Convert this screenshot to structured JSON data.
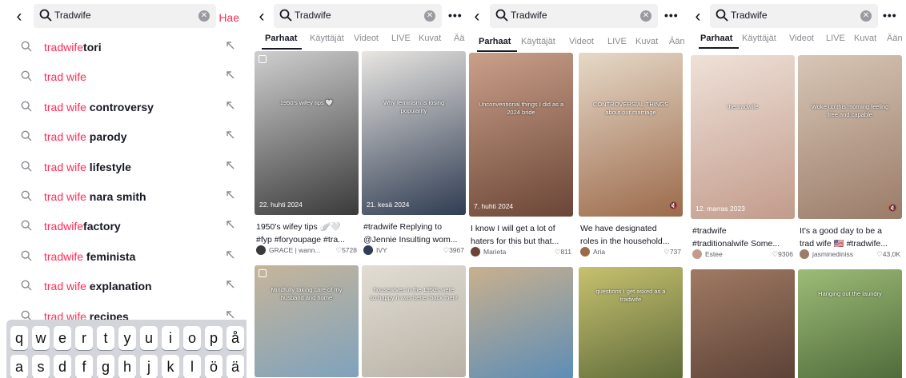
{
  "query": "Tradwife",
  "search_button": "Hae",
  "suggestions": [
    {
      "hl": "tradwife",
      "rest": "tori"
    },
    {
      "hl": "trad wife",
      "rest": ""
    },
    {
      "hl": "trad wife",
      "rest": " controversy"
    },
    {
      "hl": "trad wife",
      "rest": " parody"
    },
    {
      "hl": "trad wife",
      "rest": " lifestyle"
    },
    {
      "hl": "trad wife",
      "rest": " nara smith"
    },
    {
      "hl": "tradwife",
      "rest": "factory"
    },
    {
      "hl": "tradwife",
      "rest": " feminista"
    },
    {
      "hl": "trad wife",
      "rest": " explanation"
    },
    {
      "hl": "trad wife",
      "rest": " recipes"
    }
  ],
  "keyboard": {
    "row1": [
      "q",
      "w",
      "e",
      "r",
      "t",
      "y",
      "u",
      "i",
      "o",
      "p",
      "å"
    ],
    "row2": [
      "a",
      "s",
      "d",
      "f",
      "g",
      "h",
      "j",
      "k",
      "l",
      "ö",
      "ä"
    ]
  },
  "tabs": [
    "Parhaat",
    "Käyttäjät",
    "Videot",
    "LIVE",
    "Kuvat",
    "Ää"
  ],
  "tabs_b": [
    "Parhaat",
    "Käyttäjät",
    "Videot",
    "LIVE",
    "Kuvat",
    "Ään"
  ],
  "panels": [
    {
      "cards": [
        {
          "date": "22. huhti 2024",
          "overlay": "1950's wifey tips 🤍",
          "caption1": "1950's wifey tips 🪽🤍",
          "caption2": "#fyp #foryoupage #tra...",
          "user": "GRACE | wann...",
          "likes": "5728",
          "bg": "#3a3a3a",
          "bg2": "#cfcfcf"
        },
        {
          "date": "21. kesä 2024",
          "overlay": "Why feminism is losing popularity",
          "caption1": "#tradwife Replying to",
          "caption2": "@Jennie Insulting wom...",
          "user": "IVY",
          "likes": "3967",
          "bg": "#2f3c52",
          "bg2": "#e9e6e2"
        },
        {
          "overlay": "Mindfully taking care of my husband and home",
          "bg": "#7fa2bd",
          "bg2": "#c6b59a"
        },
        {
          "overlay": "housewives in the 1950s were so happy it was better back then!",
          "bg": "#b8b2a6",
          "bg2": "#e2ddd4"
        }
      ]
    },
    {
      "cards": [
        {
          "date": "7. huhti 2024",
          "overlay": "Unconventional things I did as a 2024 bride",
          "caption1": "I know I will get a lot of",
          "caption2": "haters for this but that...",
          "user": "Marieta",
          "likes": "811",
          "bg": "#6b4536",
          "bg2": "#caa08a"
        },
        {
          "overlay": "CONTROVERSIAL THINGS about our marriage",
          "caption1": "We have designated",
          "caption2": "roles in the household...",
          "user": "Aria",
          "likes": "737",
          "bg": "#9c6a4b",
          "bg2": "#e6d9c8"
        },
        {
          "overlay": "",
          "bg": "#5d8db6",
          "bg2": "#c9b08e"
        },
        {
          "overlay": "questions I get asked as a tradwife",
          "bg": "#5f6b3a",
          "bg2": "#c7c16f"
        }
      ]
    },
    {
      "cards": [
        {
          "date": "12. marras 2023",
          "overlay": "the tradwife",
          "caption1": "#tradwife",
          "caption2": "#traditionalwife Some...",
          "user": "Estee",
          "likes": "9306",
          "bg": "#c29b8b",
          "bg2": "#efe1d8"
        },
        {
          "overlay": "Woke up this morning feeling free and capable",
          "caption1": "It's a good day to be a",
          "caption2": "trad wife 🇺🇸 #tradwife...",
          "user": "jasminediniss",
          "likes": "43,0K",
          "bg": "#9a7c68",
          "bg2": "#d8c6b6"
        },
        {
          "overlay": "",
          "bg": "#5b4136",
          "bg2": "#a07a63"
        },
        {
          "overlay": "Hanging out the laundry",
          "bg": "#4f6a3a",
          "bg2": "#9dbb77"
        }
      ]
    }
  ],
  "icons": {
    "search": "search-icon",
    "clear": "clear-icon",
    "more": "more-icon",
    "back": "back-icon",
    "fill": "fill-arrow-icon",
    "heart": "heart-icon"
  },
  "colors": {
    "accent": "#fe2c55",
    "text": "#161823",
    "muted": "#8a8b91"
  }
}
